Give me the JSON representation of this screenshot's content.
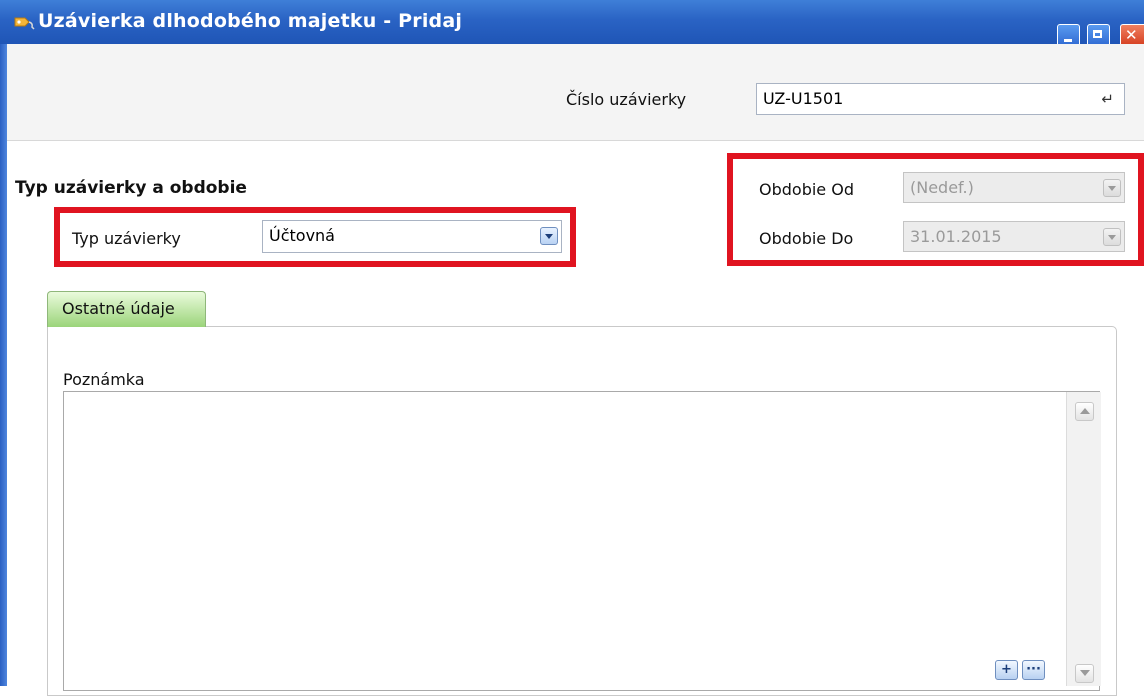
{
  "window": {
    "title": "Uzávierka dlhodobého majetku - Pridaj",
    "icon": "key-tag-icon",
    "controls": [
      "minimize-icon",
      "maximize-icon",
      "close-icon"
    ]
  },
  "header": {
    "cislo_label": "Číslo uzávierky",
    "cislo_value": "UZ-U1501",
    "cislo_icon": "refresh-icon"
  },
  "section": {
    "title": "Typ uzávierky a obdobie"
  },
  "typ": {
    "label": "Typ uzávierky",
    "value": "Účtovná"
  },
  "obdobie": {
    "od_label": "Obdobie Od",
    "od_value": "(Nedef.)",
    "do_label": "Obdobie Do",
    "do_value": "31.01.2015"
  },
  "tabs": [
    {
      "label": "Ostatné údaje",
      "active": true
    }
  ],
  "poznamka": {
    "label": "Poznámka",
    "value": "",
    "buttons": {
      "add": "+",
      "more": "···"
    }
  },
  "colors": {
    "highlight": "#e01420",
    "titlebar": "#2a63c4",
    "tab_active": "#9bd47a"
  }
}
